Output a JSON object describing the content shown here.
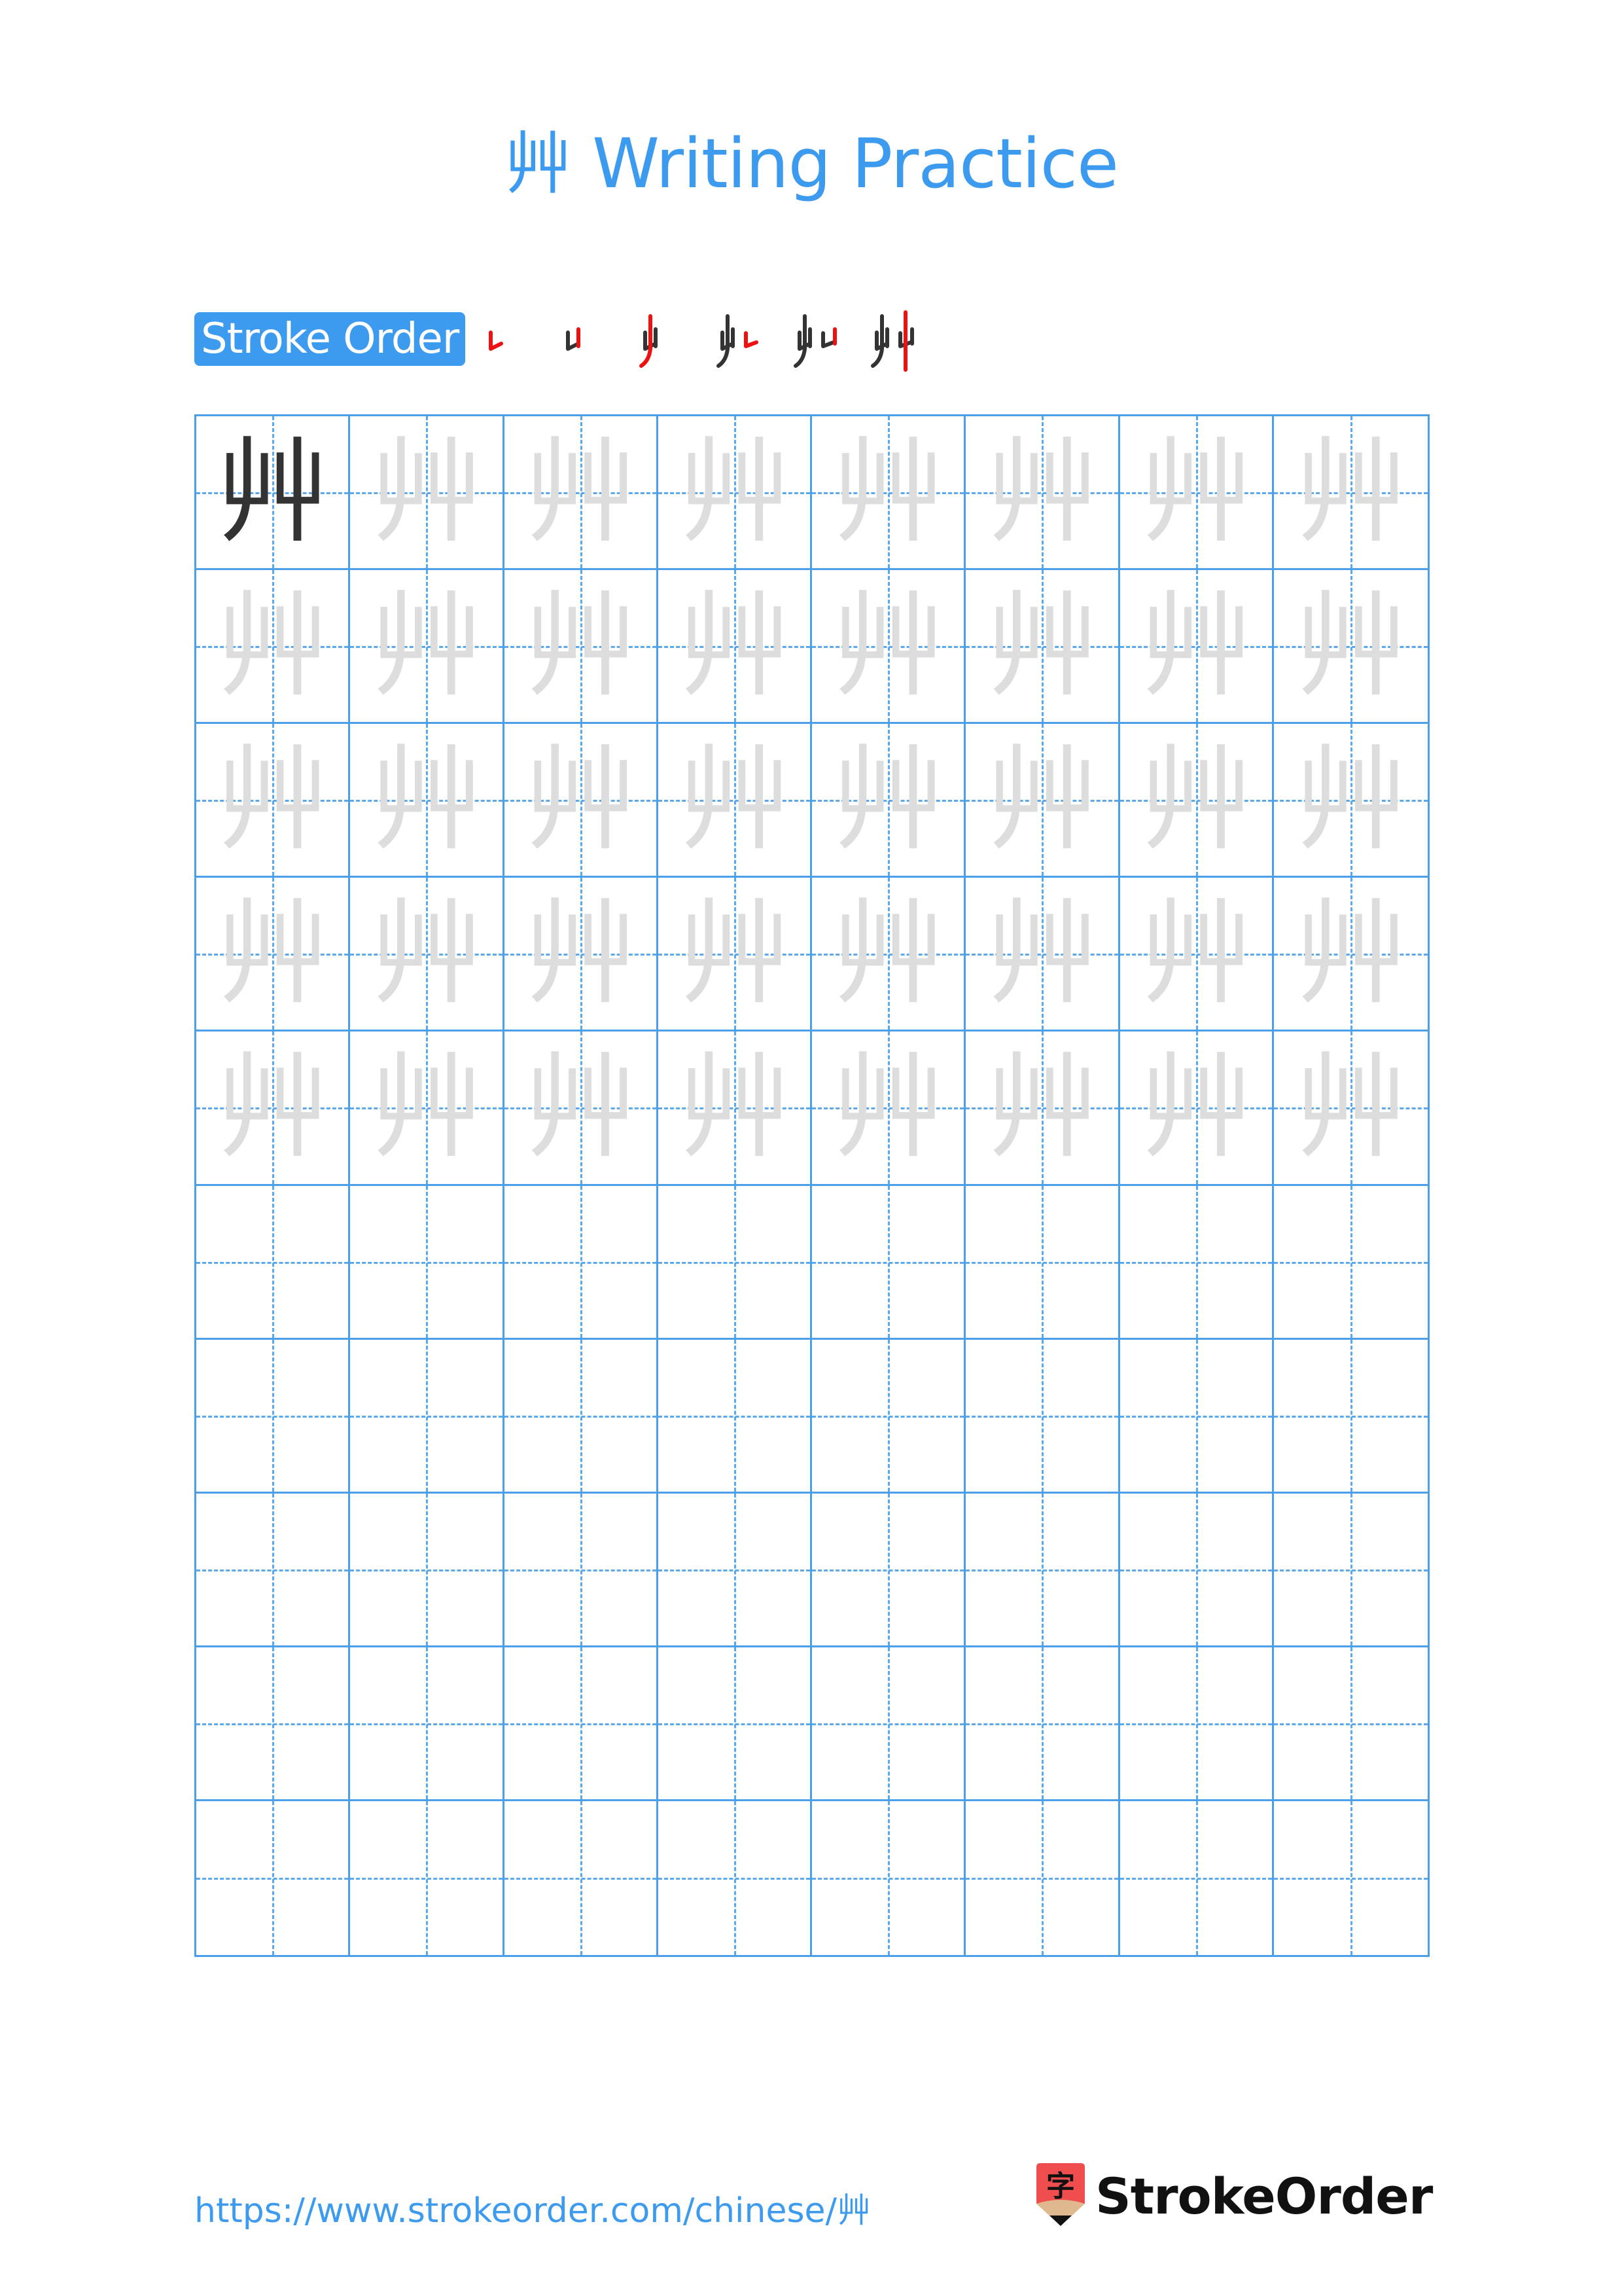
{
  "title": "艸 Writing Practice",
  "character": "艸",
  "stroke_order": {
    "label": "Stroke Order",
    "step_count": 6,
    "steps": [
      {
        "step": 1,
        "strokes": "㇄",
        "highlight": "stroke 1"
      },
      {
        "step": 2,
        "strokes": "凵",
        "highlight": "stroke 2"
      },
      {
        "step": 3,
        "strokes": "屮",
        "highlight": "stroke 3"
      },
      {
        "step": 4,
        "strokes": "屮㇄",
        "highlight": "stroke 4"
      },
      {
        "step": 5,
        "strokes": "屮凵",
        "highlight": "stroke 5"
      },
      {
        "step": 6,
        "strokes": "艸",
        "highlight": "stroke 6"
      }
    ],
    "highlight_color": "#ee1111",
    "done_color": "#333333"
  },
  "grid": {
    "columns": 8,
    "rows": 10,
    "traced_rows": 5,
    "first_cell_style": "dark",
    "trace_style": "light",
    "line_color": "#4a9fe8"
  },
  "footer": {
    "url": "https://www.strokeorder.com/chinese/艸",
    "logo_text": "StrokeOrder",
    "logo_glyph": "字"
  },
  "colors": {
    "accent": "#3d9bef",
    "logo_red": "#f04e4e",
    "logo_tan": "#dfb88f"
  }
}
